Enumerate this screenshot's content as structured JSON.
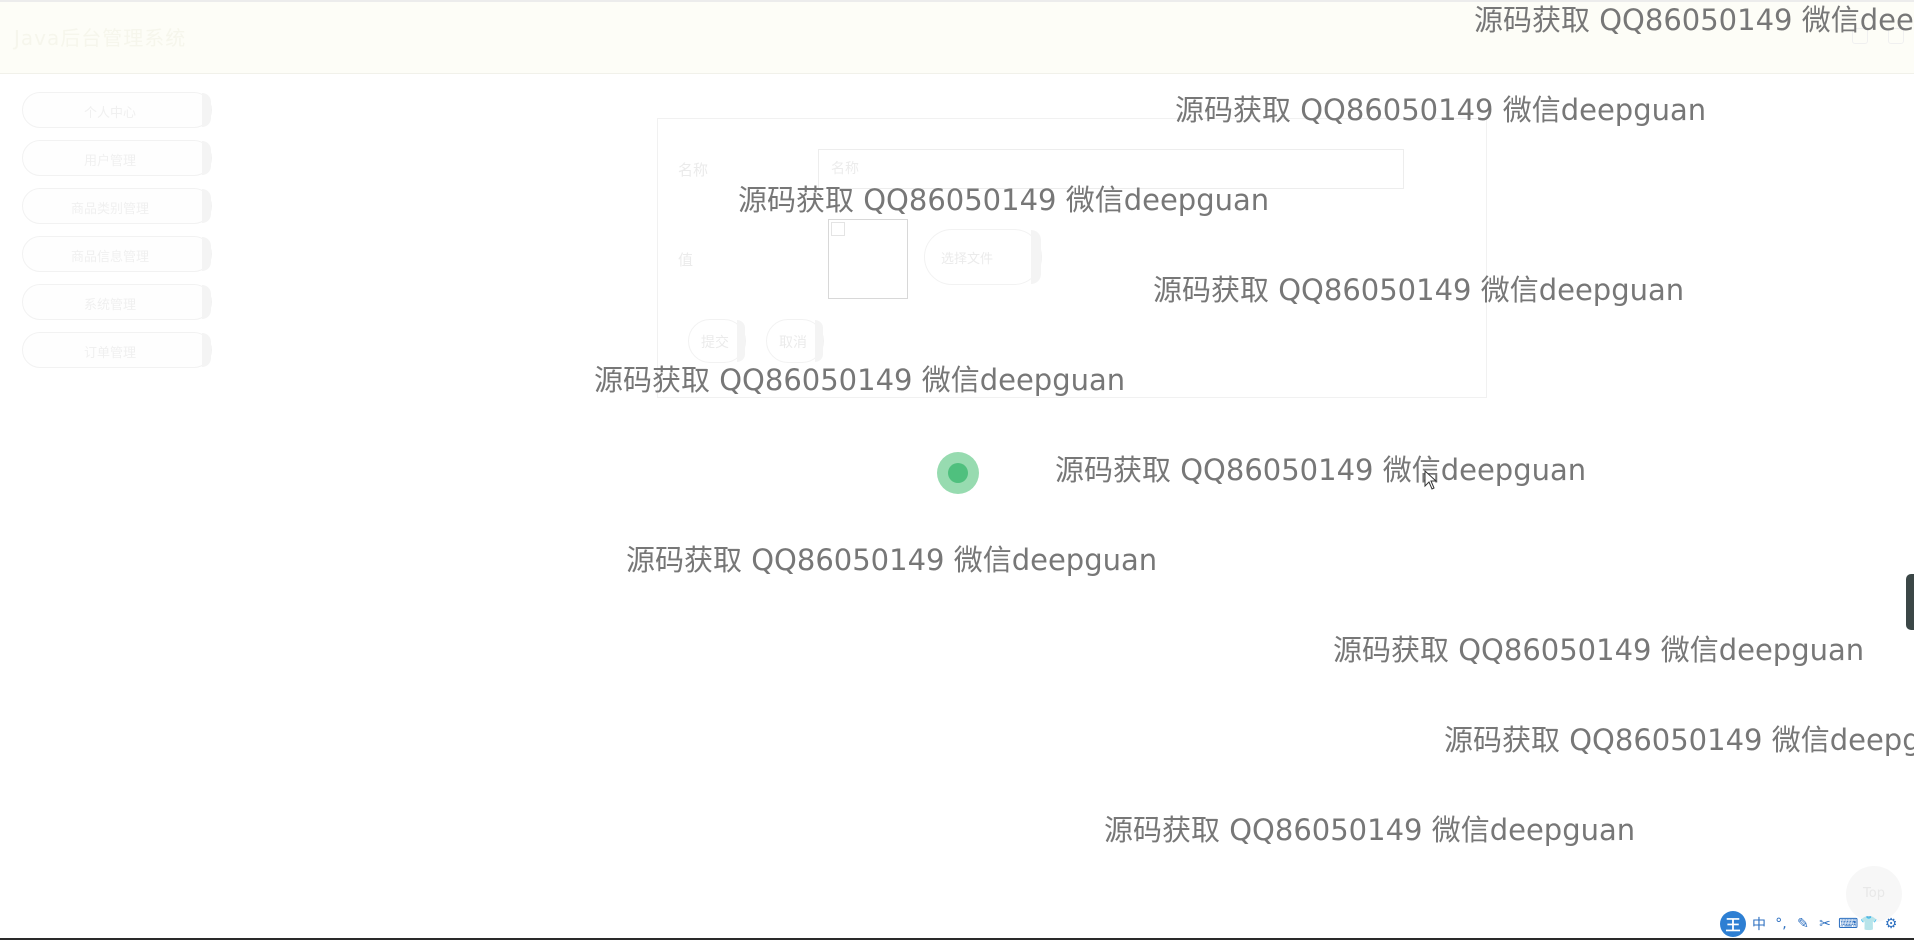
{
  "header": {
    "title": "Java后台管理系统"
  },
  "sidebar": {
    "items": [
      {
        "label": "个人中心"
      },
      {
        "label": "用户管理"
      },
      {
        "label": "商品类别管理"
      },
      {
        "label": "商品信息管理"
      },
      {
        "label": "系统管理"
      },
      {
        "label": "订单管理"
      }
    ]
  },
  "form": {
    "name_label": "名称",
    "name_placeholder": "名称",
    "value_label": "值",
    "file_button": "选择文件",
    "submit_button": "提交",
    "cancel_button": "取消"
  },
  "watermark": {
    "text": "源码获取 QQ86050149 微信deepguan",
    "count": 11
  },
  "back_top": {
    "label": "Top"
  },
  "ime_toolbar": {
    "logo": "王",
    "items": [
      "中",
      "°,",
      "✎",
      "✂",
      "⌨",
      "👕",
      "⚙"
    ]
  },
  "colors": {
    "loading_outer": "#97dbb0",
    "loading_inner": "#4fc07e",
    "watermark": "#777777",
    "ime_accent": "#2d7fd3"
  }
}
